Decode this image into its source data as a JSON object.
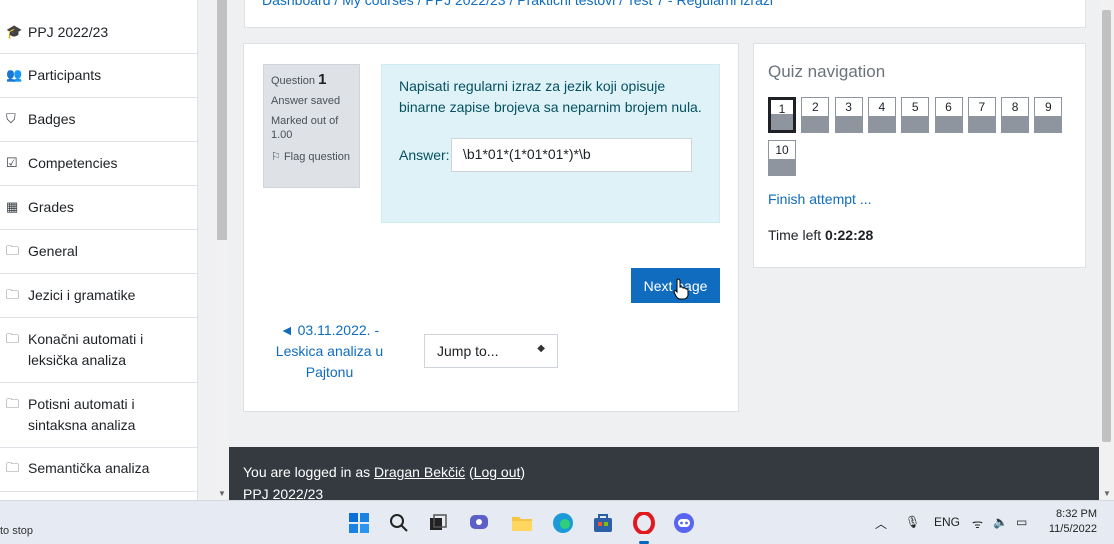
{
  "breadcrumb": "Dashboard / My courses / PPJ 2022/23 / Praktični testovi / Test 7 - Regularni izrazi",
  "sidebar": {
    "items": [
      {
        "label": "PPJ 2022/23",
        "icon": "graduation-cap-icon"
      },
      {
        "label": "Participants",
        "icon": "users-icon"
      },
      {
        "label": "Badges",
        "icon": "shield-icon"
      },
      {
        "label": "Competencies",
        "icon": "checkbox-icon"
      },
      {
        "label": "Grades",
        "icon": "table-icon"
      },
      {
        "label": "General",
        "icon": "folder-icon"
      },
      {
        "label": "Jezici i gramatike",
        "icon": "folder-icon"
      },
      {
        "label": "Konačni automati i leksička analiza",
        "icon": "folder-icon"
      },
      {
        "label": "Potisni automati i sintaksna analiza",
        "icon": "folder-icon"
      },
      {
        "label": "Semantička analiza",
        "icon": "folder-icon"
      }
    ]
  },
  "question": {
    "label": "Question",
    "number": "1",
    "status": "Answer saved",
    "marked": "Marked out of 1.00",
    "flag": "Flag question",
    "text": "Napisati regularni izraz za jezik koji opisuje binarne zapise brojeva sa neparnim brojem nula.",
    "answer_label": "Answer:",
    "answer_value": "\\b1*01*(1*01*01*)*\\b"
  },
  "next_button": "Next page",
  "prev_link": "◄ 03.11.2022. - Leskica analiza u Pajtonu",
  "jump_select": "Jump to...",
  "quiz_nav": {
    "title": "Quiz navigation",
    "buttons": [
      "1",
      "2",
      "3",
      "4",
      "5",
      "6",
      "7",
      "8",
      "9",
      "10"
    ],
    "current": "1",
    "finish": "Finish attempt ...",
    "time_label": "Time left",
    "time_value": "0:22:28"
  },
  "footer": {
    "logged_prefix": "You are logged in as",
    "user": "Dragan Bekčić",
    "logout": "Log out",
    "course": "PPJ 2022/23"
  },
  "taskbar": {
    "status_text": "to stop",
    "lang": "ENG",
    "time": "8:32 PM",
    "date": "11/5/2022"
  },
  "colors": {
    "primary": "#0f6cbf",
    "footer": "#343a40",
    "question_bg": "#def2f8",
    "info_bg": "#dee2e6"
  }
}
